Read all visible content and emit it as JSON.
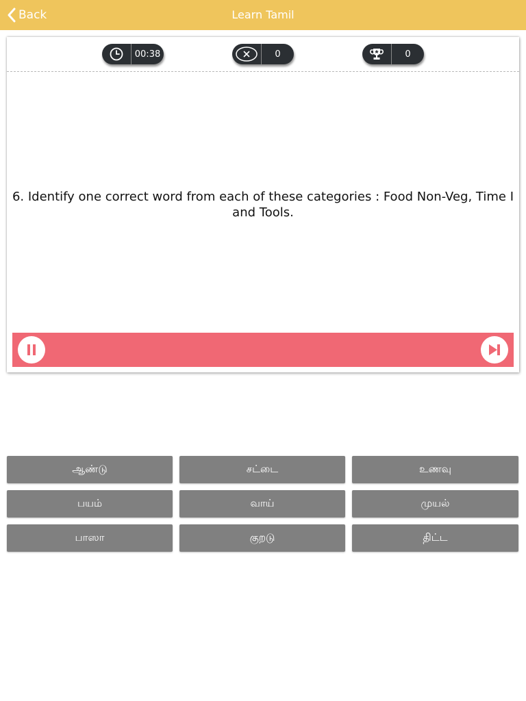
{
  "nav": {
    "back_label": "Back",
    "title": "Learn Tamil"
  },
  "stats": {
    "timer": "00:38",
    "wrong_count": "0",
    "score": "0"
  },
  "question": {
    "text": "6. Identify one correct word from each of these categories : Food Non-Veg, Time I and Tools."
  },
  "controls": {
    "pause_icon": "pause-icon",
    "next_icon": "skip-next-icon"
  },
  "answers": [
    {
      "label": "ஆண்டு"
    },
    {
      "label": "சட்டை"
    },
    {
      "label": "உணவு"
    },
    {
      "label": "பயம்"
    },
    {
      "label": "வாய்"
    },
    {
      "label": "முயல்"
    },
    {
      "label": "பாஸா"
    },
    {
      "label": "குறடு"
    },
    {
      "label": "திட்ட"
    }
  ],
  "colors": {
    "navbar": "#efc55c",
    "control_bar": "#f06874",
    "answer_button": "#808080",
    "stat_pill": "#2b2f33"
  }
}
